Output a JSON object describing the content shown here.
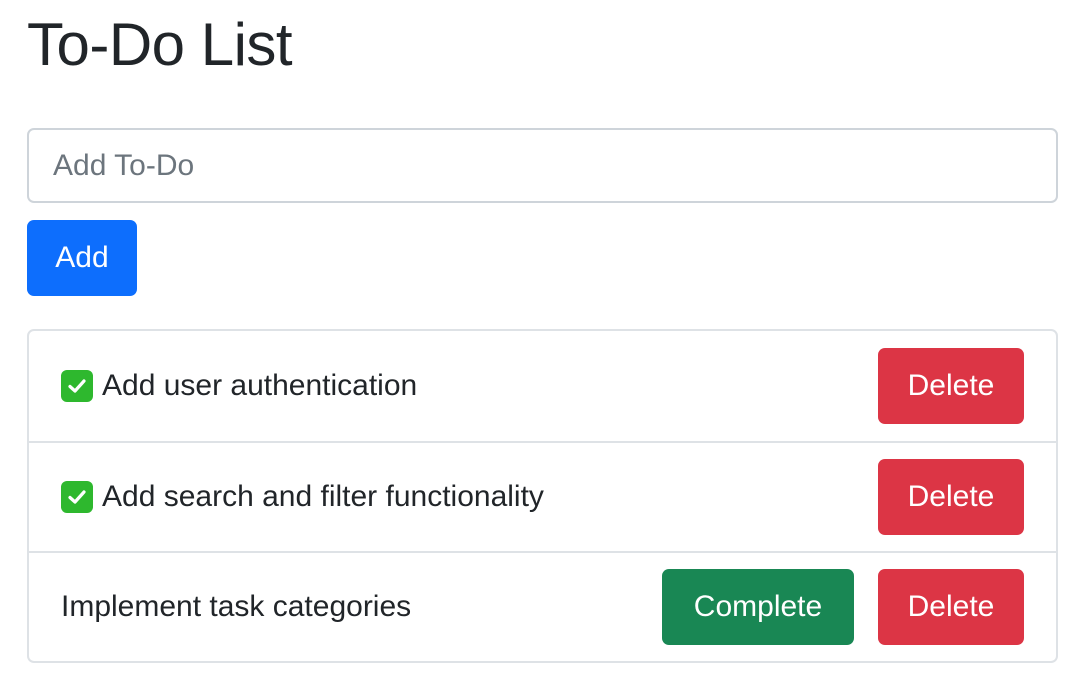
{
  "page": {
    "title": "To-Do List"
  },
  "form": {
    "input_placeholder": "Add To-Do",
    "input_value": "",
    "add_label": "Add"
  },
  "todos": [
    {
      "text": "Add user authentication",
      "completed": true,
      "delete_label": "Delete"
    },
    {
      "text": "Add search and filter functionality",
      "completed": true,
      "delete_label": "Delete"
    },
    {
      "text": "Implement task categories",
      "completed": false,
      "complete_label": "Complete",
      "delete_label": "Delete"
    }
  ],
  "icons": {
    "completed": "check-box-icon"
  },
  "colors": {
    "primary": "#0d6efd",
    "success": "#198754",
    "danger": "#dc3545",
    "check": "#2eb82e",
    "text": "#212529",
    "border": "#dee2e6"
  }
}
